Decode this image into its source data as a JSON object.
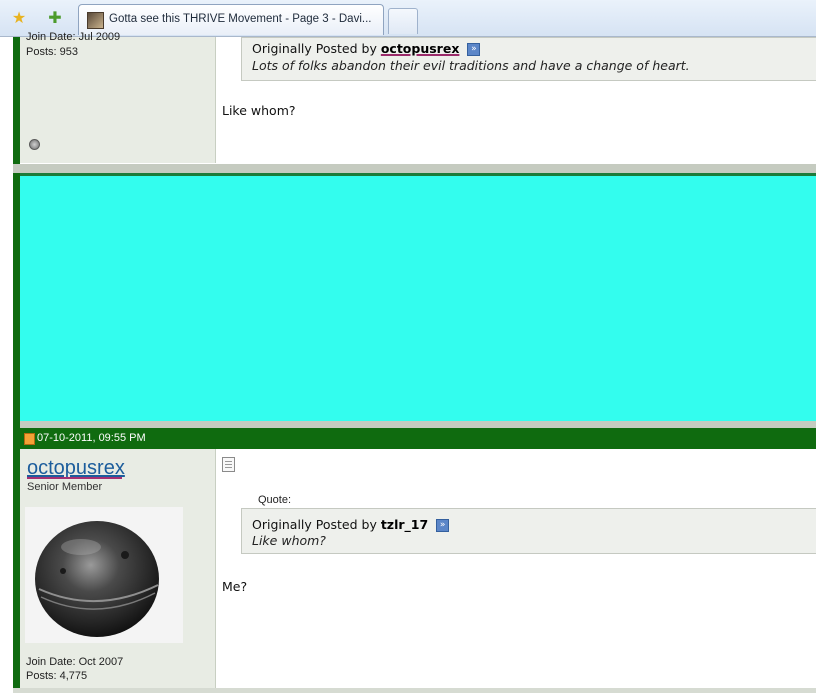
{
  "browser": {
    "tab_title": "Gotta see this THRIVE Movement - Page 3 - Davi..."
  },
  "post_prev": {
    "join_date": "Join Date: Jul 2009",
    "posts": "Posts: 953",
    "quote_prefix": "Originally Posted by",
    "quote_author": "octopusrex",
    "quote_text": "Lots of folks abandon their evil traditions and have a change of heart.",
    "message": "Like whom?"
  },
  "post_next": {
    "date": "07-10-2011, 09:55 PM",
    "username": "octopusrex",
    "user_title": "Senior Member",
    "quote_label": "Quote:",
    "quote_prefix": "Originally Posted by",
    "quote_author": "tzlr_17",
    "quote_text": "Like whom?",
    "message": "Me?",
    "join_date": "Join Date: Oct 2007",
    "posts": "Posts: 4,775"
  },
  "colors": {
    "forum_green": "#0f6b0f",
    "ad_cyan": "#33fdee",
    "username_blue": "#1c5d9c"
  },
  "icons": [
    "star-icon",
    "add-favorite-icon",
    "tab-favicon",
    "post-icon",
    "view-post-arrow-icon",
    "online-status-icon",
    "date-post-icon"
  ]
}
